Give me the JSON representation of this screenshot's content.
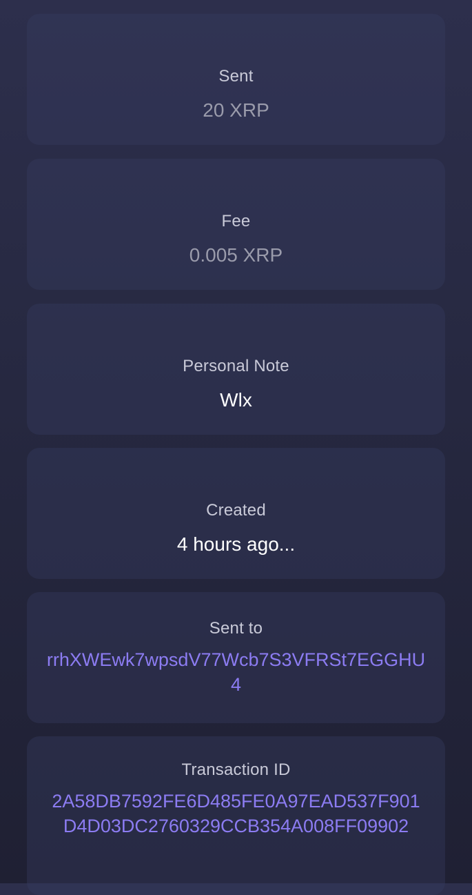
{
  "details": {
    "sent": {
      "label": "Sent",
      "value": "20 XRP"
    },
    "fee": {
      "label": "Fee",
      "value": "0.005 XRP"
    },
    "note": {
      "label": "Personal Note",
      "value": "Wlx"
    },
    "created": {
      "label": "Created",
      "value": "4 hours ago..."
    },
    "sent_to": {
      "label": "Sent to",
      "value": "rrhXWEwk7wpsdV77Wcb7S3VFRSt7EGGHU4"
    },
    "transaction_id": {
      "label": "Transaction ID",
      "value": "2A58DB7592FE6D485FE0A97EAD537F901D4D03DC2760329CCB354A008FF09902"
    }
  },
  "colors": {
    "link": "#8c7cf2",
    "label": "#c9cad8",
    "muted_value": "#9a9bab",
    "white_value": "#ffffff"
  }
}
